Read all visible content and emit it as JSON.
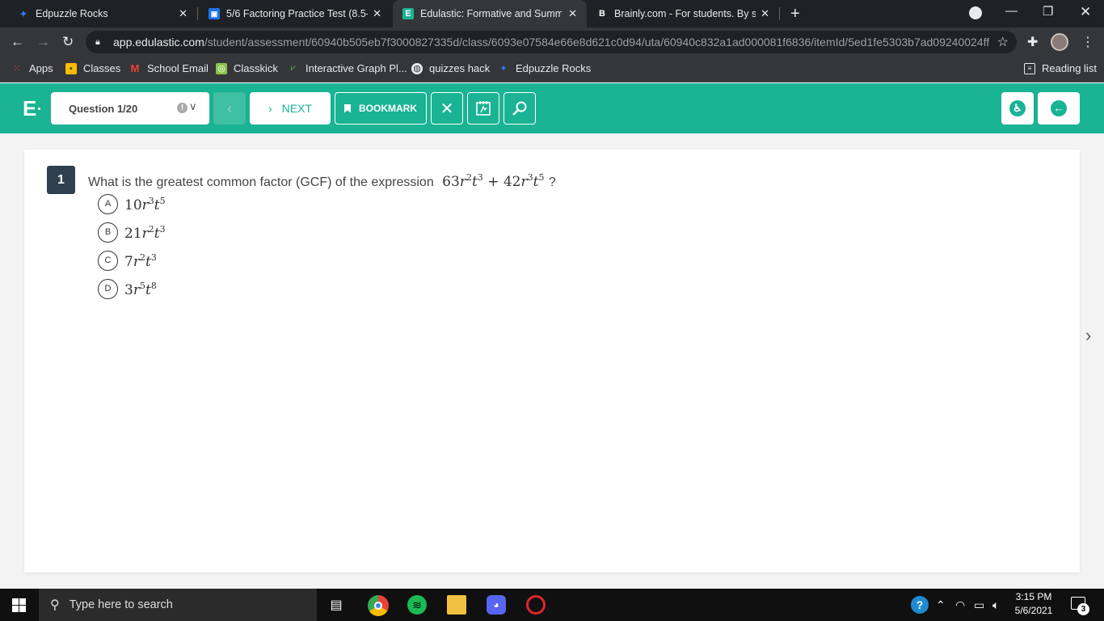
{
  "browser": {
    "tabs": [
      {
        "title": "Edpuzzle Rocks",
        "icon": "edpuzzle-icon"
      },
      {
        "title": "5/6 Factoring Practice Test (8.5-8",
        "icon": "google-classroom-icon"
      },
      {
        "title": "Edulastic: Formative and Summat",
        "icon": "edulastic-icon",
        "active": true
      },
      {
        "title": "Brainly.com - For students. By stu",
        "icon": "brainly-icon"
      }
    ],
    "url_host": "app.edulastic.com",
    "url_path": "/student/assessment/60940b505eb7f3000827335d/class/6093e07584e66e8d621c0d94/uta/60940c832a1ad000081f6836/itemId/5ed1fe5303b7ad09240024ff",
    "bookmarks": [
      {
        "label": "Apps",
        "icon": "apps-grid-icon"
      },
      {
        "label": "Classes",
        "icon": "classes-icon"
      },
      {
        "label": "School Email",
        "icon": "gmail-icon"
      },
      {
        "label": "Classkick",
        "icon": "classkick-icon"
      },
      {
        "label": "Interactive Graph Pl...",
        "icon": "graph-icon"
      },
      {
        "label": "quizzes hack",
        "icon": "globe-icon"
      },
      {
        "label": "Edpuzzle Rocks",
        "icon": "edpuzzle-icon"
      }
    ],
    "reading_list": "Reading list"
  },
  "app": {
    "logo": "E",
    "question_selector": "Question 1/20",
    "next_label": "NEXT",
    "bookmark_label": "BOOKMARK",
    "accent_color": "#1ab394"
  },
  "question": {
    "number": "1",
    "text": "What is the greatest common factor (GCF) of the expression",
    "expression": {
      "c1": "63",
      "v1": "r",
      "e1": "2",
      "v2": "t",
      "e2": "3",
      "op": "+",
      "c2": "42",
      "v3": "r",
      "e3": "3",
      "v4": "t",
      "e4": "5"
    },
    "end": "?",
    "options": [
      {
        "letter": "A",
        "coef": "10",
        "r_exp": "3",
        "t_exp": "5"
      },
      {
        "letter": "B",
        "coef": "21",
        "r_exp": "2",
        "t_exp": "3"
      },
      {
        "letter": "C",
        "coef": "7",
        "r_exp": "2",
        "t_exp": "3"
      },
      {
        "letter": "D",
        "coef": "3",
        "r_exp": "5",
        "t_exp": "8"
      }
    ]
  },
  "taskbar": {
    "search_placeholder": "Type here to search",
    "time": "3:15 PM",
    "date": "5/6/2021",
    "notifications": "3"
  }
}
